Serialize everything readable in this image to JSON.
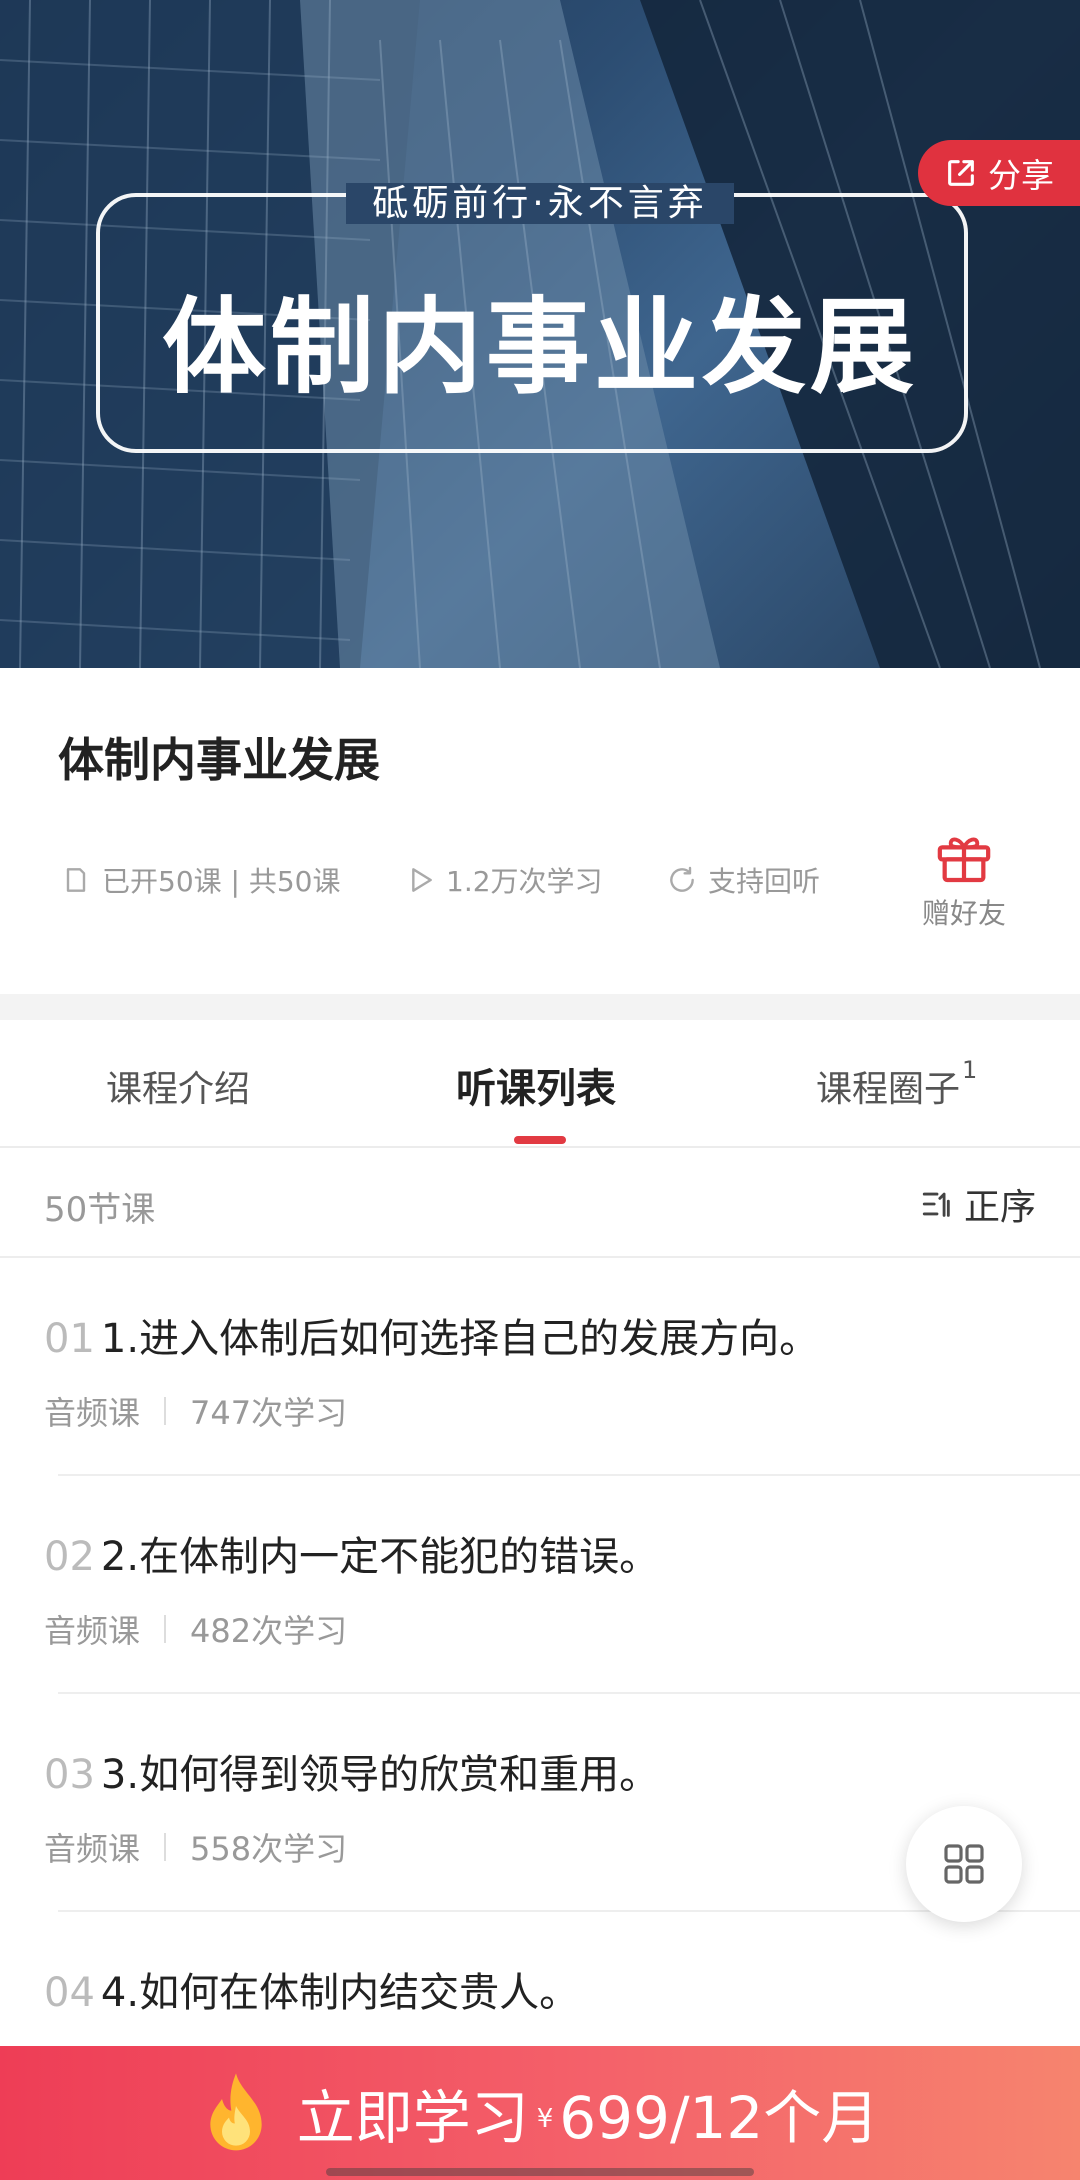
{
  "banner": {
    "subtitle": "砥砺前行·永不言弃",
    "title": "体制内事业发展",
    "share_label": "分享"
  },
  "course": {
    "title": "体制内事业发展",
    "lessons_meta": "已开50课 | 共50课",
    "plays_meta": "1.2万次学习",
    "replay_meta": "支持回听",
    "gift_label": "赠好友"
  },
  "tabs": [
    {
      "label": "课程介绍",
      "badge": ""
    },
    {
      "label": "听课列表",
      "badge": ""
    },
    {
      "label": "课程圈子",
      "badge": "1"
    }
  ],
  "list": {
    "count_label": "50节课",
    "sort_label": "正序",
    "lessons": [
      {
        "num": "01",
        "title": "1.进入体制后如何选择自己的发展方向。",
        "type": "音频课",
        "plays": "747次学习"
      },
      {
        "num": "02",
        "title": "2.在体制内一定不能犯的错误。",
        "type": "音频课",
        "plays": "482次学习"
      },
      {
        "num": "03",
        "title": "3.如何得到领导的欣赏和重用。",
        "type": "音频课",
        "plays": "558次学习"
      },
      {
        "num": "04",
        "title": "4.如何在体制内结交贵人。",
        "type": "",
        "plays": ""
      }
    ]
  },
  "cta": {
    "label": "立即学习",
    "currency": "¥",
    "price": "699/12个月"
  },
  "colors": {
    "accent": "#e23a42",
    "share_bg": "#e0323f",
    "cta_start": "#ee3d56",
    "cta_end": "#f6846e"
  },
  "icons": [
    "share-icon",
    "document-icon",
    "play-icon",
    "replay-icon",
    "gift-icon",
    "sort-icon",
    "grid-icon",
    "flame-icon"
  ]
}
